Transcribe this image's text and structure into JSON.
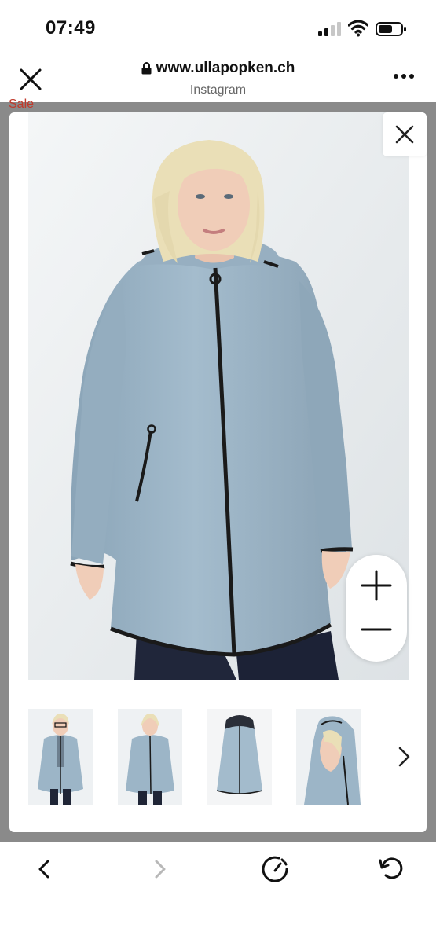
{
  "status_bar": {
    "time": "07:49"
  },
  "browser": {
    "url": "www.ullapopken.ch",
    "subtitle": "Instagram"
  },
  "page": {
    "sale_label": "Sale"
  },
  "product": {
    "jacket_color": "#9eb6c8",
    "thumbnails": [
      "front-open",
      "front",
      "product-only",
      "hood-side"
    ]
  },
  "icons": {
    "close": "close-icon",
    "lock": "lock-icon",
    "more": "more-icon",
    "zoom_in": "plus-icon",
    "zoom_out": "minus-icon",
    "next": "chevron-right-icon",
    "back": "back-icon",
    "forward": "forward-icon",
    "speed": "speedometer-icon",
    "reload": "reload-icon"
  }
}
